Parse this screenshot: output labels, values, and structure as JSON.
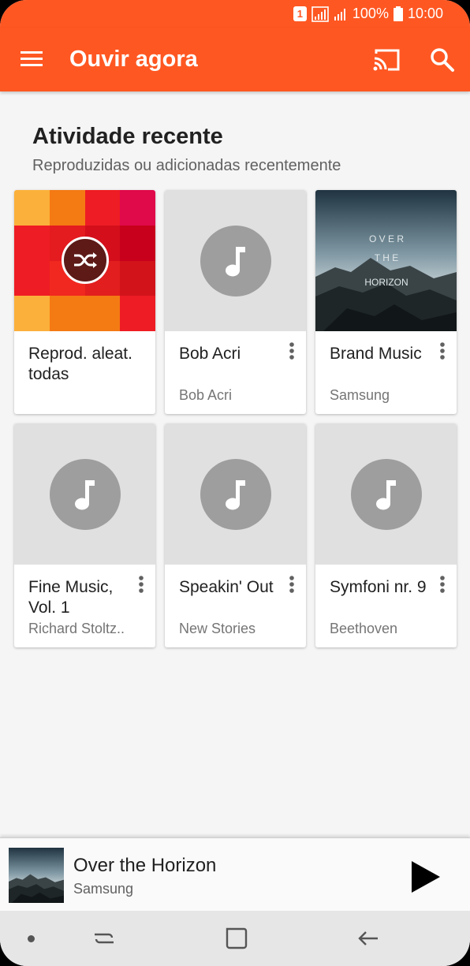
{
  "status": {
    "sim": "1",
    "battery": "100%",
    "time": "10:00"
  },
  "appbar": {
    "title": "Ouvir agora"
  },
  "section": {
    "title": "Atividade recente",
    "subtitle": "Reproduzidas ou adicionadas recentemente"
  },
  "cards": [
    {
      "title": "Reprod. aleat. todas",
      "subtitle": ""
    },
    {
      "title": "Bob Acri",
      "subtitle": "Bob Acri"
    },
    {
      "title": "Brand Music",
      "subtitle": "Samsung"
    },
    {
      "title": "Fine Music, Vol. 1",
      "subtitle": "Richard Stoltz.."
    },
    {
      "title": "Speakin' Out",
      "subtitle": "New Stories"
    },
    {
      "title": "Symfoni nr. 9",
      "subtitle": "Beethoven"
    }
  ],
  "album_art_text": {
    "line1": "O V E R",
    "line2": "T H E",
    "line3": "HORIZON"
  },
  "now_playing": {
    "title": "Over the Horizon",
    "artist": "Samsung"
  },
  "colors": {
    "primary": "#ff5722",
    "placeholder_art": "#e0e0e0",
    "placeholder_circle": "#9e9e9e",
    "shuffle_tiles": [
      "#fbb03b",
      "#f47a14",
      "#ee1c24",
      "#e0094a",
      "#ee1c24",
      "#e41b1f",
      "#d40f1b",
      "#c8001c",
      "#ee1c24",
      "#f1281f",
      "#e21e1e",
      "#d2131a",
      "#fbb03b",
      "#f47a14",
      "#f47a14",
      "#ee1c24"
    ]
  },
  "icons": {
    "menu": "hamburger-menu-icon",
    "cast": "cast-icon",
    "search": "search-icon",
    "shuffle": "shuffle-icon",
    "note": "music-note-icon",
    "more": "more-vertical-icon",
    "play": "play-icon",
    "nav_recent": "recent-apps-icon",
    "nav_home": "home-icon",
    "nav_back": "back-icon"
  }
}
